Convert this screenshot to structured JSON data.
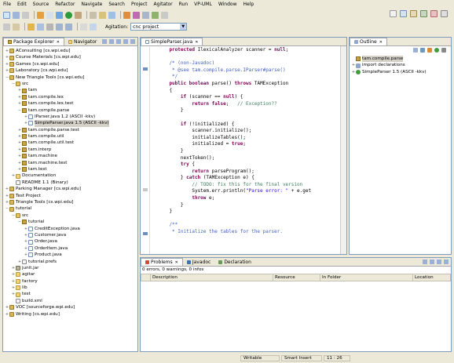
{
  "menu": [
    "File",
    "Edit",
    "Source",
    "Refactor",
    "Navigate",
    "Search",
    "Project",
    "Agitator",
    "Run",
    "VP-UML",
    "Window",
    "Help"
  ],
  "toolbar": {
    "agitation_label": "Agitation:",
    "agitation_value": "cnc project"
  },
  "package_explorer": {
    "tabs": [
      "Package Explorer",
      "Navigator"
    ],
    "tree": [
      {
        "depth": 0,
        "tw": "+",
        "icon": "proj",
        "label": "AConsulting  [cs.wpi.edu]"
      },
      {
        "depth": 0,
        "tw": "+",
        "icon": "proj",
        "label": "Course Materials  [cs.wpi.edu]"
      },
      {
        "depth": 0,
        "tw": "+",
        "icon": "proj",
        "label": "Games  [cs.wpi.edu]"
      },
      {
        "depth": 0,
        "tw": "+",
        "icon": "proj",
        "label": "Laboratory  [cs.wpi.edu]"
      },
      {
        "depth": 0,
        "tw": "−",
        "icon": "proj",
        "label": "New Triangle Tools  [cs.wpi.edu]"
      },
      {
        "depth": 1,
        "tw": "−",
        "icon": "src",
        "label": "src"
      },
      {
        "depth": 2,
        "tw": "+",
        "icon": "pkg",
        "label": "tam"
      },
      {
        "depth": 2,
        "tw": "+",
        "icon": "pkg",
        "label": "tam.compile.lex"
      },
      {
        "depth": 2,
        "tw": "+",
        "icon": "pkg",
        "label": "tam.compile.lex.test"
      },
      {
        "depth": 2,
        "tw": "−",
        "icon": "pkg",
        "label": "tam.compile.parse"
      },
      {
        "depth": 3,
        "tw": "+",
        "icon": "java",
        "label": "IParser.java 1.2  (ASCII -kkv)"
      },
      {
        "depth": 3,
        "tw": "+",
        "icon": "java",
        "label": "SimpleParser.java 1.5  (ASCII -kkv)",
        "selected": true
      },
      {
        "depth": 2,
        "tw": "+",
        "icon": "pkg",
        "label": "tam.compile.parse.test"
      },
      {
        "depth": 2,
        "tw": "+",
        "icon": "pkg",
        "label": "tam.compile.util"
      },
      {
        "depth": 2,
        "tw": "+",
        "icon": "pkg",
        "label": "tam.compile.util.test"
      },
      {
        "depth": 2,
        "tw": "+",
        "icon": "pkg",
        "label": "tam.interp"
      },
      {
        "depth": 2,
        "tw": "+",
        "icon": "pkg",
        "label": "tam.machine"
      },
      {
        "depth": 2,
        "tw": "+",
        "icon": "pkg",
        "label": "tam.machine.test"
      },
      {
        "depth": 2,
        "tw": "+",
        "icon": "pkg",
        "label": "tam.test"
      },
      {
        "depth": 1,
        "tw": "+",
        "icon": "folder",
        "label": "Documentation"
      },
      {
        "depth": 1,
        "tw": "",
        "icon": "file",
        "label": "README 1.1  (Binary)"
      },
      {
        "depth": 0,
        "tw": "+",
        "icon": "proj",
        "label": "Parking Manager  [cs.wpi.edu]"
      },
      {
        "depth": 0,
        "tw": "+",
        "icon": "proj",
        "label": "Test Project"
      },
      {
        "depth": 0,
        "tw": "+",
        "icon": "proj",
        "label": "Triangle Tools  [cs.wpi.edu]"
      },
      {
        "depth": 0,
        "tw": "−",
        "icon": "proj",
        "label": "tutorial"
      },
      {
        "depth": 1,
        "tw": "−",
        "icon": "src",
        "label": "src"
      },
      {
        "depth": 2,
        "tw": "−",
        "icon": "pkg",
        "label": "tutorial"
      },
      {
        "depth": 3,
        "tw": "+",
        "icon": "java",
        "label": "CreditException.java"
      },
      {
        "depth": 3,
        "tw": "+",
        "icon": "java",
        "label": "Customer.java"
      },
      {
        "depth": 3,
        "tw": "+",
        "icon": "java",
        "label": "Order.java"
      },
      {
        "depth": 3,
        "tw": "+",
        "icon": "java",
        "label": "OrderItem.java"
      },
      {
        "depth": 3,
        "tw": "+",
        "icon": "java",
        "label": "Product.java"
      },
      {
        "depth": 2,
        "tw": "+",
        "icon": "file",
        "label": "tutorial.prefs"
      },
      {
        "depth": 1,
        "tw": "+",
        "icon": "lib",
        "label": "junit.jar"
      },
      {
        "depth": 1,
        "tw": "+",
        "icon": "folder",
        "label": "agitar"
      },
      {
        "depth": 1,
        "tw": "+",
        "icon": "folder",
        "label": "factory"
      },
      {
        "depth": 1,
        "tw": "+",
        "icon": "folder",
        "label": "lib"
      },
      {
        "depth": 1,
        "tw": "+",
        "icon": "folder",
        "label": "test"
      },
      {
        "depth": 1,
        "tw": "",
        "icon": "file",
        "label": "build.xml"
      },
      {
        "depth": 0,
        "tw": "+",
        "icon": "proj",
        "label": "VOC  [sourceforge.wpi.edu]"
      },
      {
        "depth": 0,
        "tw": "+",
        "icon": "proj",
        "label": "Writing  [cs.wpi.edu]"
      }
    ]
  },
  "editor": {
    "tab_label": "SimpleParser.java",
    "lines": [
      [
        [
          "kw",
          "    protected "
        ],
        [
          "",
          "IlexicalAnalyzer scanner = "
        ],
        [
          "kw",
          "null"
        ],
        [
          "",
          ";"
        ]
      ],
      [
        [
          "",
          ""
        ]
      ],
      [
        [
          "cm",
          "    /* (non-Javadoc)"
        ]
      ],
      [
        [
          "cm",
          "     * @see tam.compile.parse.IParser#parse()"
        ]
      ],
      [
        [
          "cm",
          "     */"
        ]
      ],
      [
        [
          "kw",
          "    public boolean "
        ],
        [
          "",
          "parse() "
        ],
        [
          "kw",
          "throws "
        ],
        [
          "",
          "TAMException"
        ]
      ],
      [
        [
          "",
          "    {"
        ]
      ],
      [
        [
          "kw",
          "        if "
        ],
        [
          "",
          "(scanner == "
        ],
        [
          "kw",
          "null"
        ],
        [
          "",
          ") {"
        ]
      ],
      [
        [
          "kw",
          "            return false"
        ],
        [
          "",
          ";   "
        ],
        [
          "cm2",
          "// Exception??"
        ]
      ],
      [
        [
          "",
          "        }"
        ]
      ],
      [
        [
          "",
          ""
        ]
      ],
      [
        [
          "kw",
          "        if "
        ],
        [
          "",
          "(!initialized) {"
        ]
      ],
      [
        [
          "",
          "            scanner.initialize();"
        ]
      ],
      [
        [
          "",
          "            initializeTables();"
        ]
      ],
      [
        [
          "",
          "            initialized = "
        ],
        [
          "kw",
          "true"
        ],
        [
          "",
          ";"
        ]
      ],
      [
        [
          "",
          "        }"
        ]
      ],
      [
        [
          "",
          "        nextToken();"
        ]
      ],
      [
        [
          "kw",
          "        try "
        ],
        [
          "",
          "{"
        ]
      ],
      [
        [
          "kw",
          "            return "
        ],
        [
          "",
          "parseProgram();"
        ]
      ],
      [
        [
          "",
          "        } "
        ],
        [
          "kw",
          "catch "
        ],
        [
          "",
          "(TAMException e) {"
        ]
      ],
      [
        [
          "cm2",
          "            // TODO: fix this for the final version"
        ]
      ],
      [
        [
          "",
          "            System.err.println("
        ],
        [
          "st",
          "\"Parse error: \""
        ],
        [
          "",
          " + e.get"
        ]
      ],
      [
        [
          "kw",
          "            throw "
        ],
        [
          "",
          "e;"
        ]
      ],
      [
        [
          "",
          "        }"
        ]
      ],
      [
        [
          "",
          "    }"
        ]
      ],
      [
        [
          "",
          ""
        ]
      ],
      [
        [
          "cm",
          "    /**"
        ]
      ],
      [
        [
          "cm",
          "     * Initialize the tables for the parser."
        ]
      ]
    ]
  },
  "outline": {
    "tab_label": "Outline",
    "items": [
      {
        "depth": 0,
        "tw": "",
        "icon": "pkg",
        "label": "tam.compile.parse",
        "selected": true
      },
      {
        "depth": 0,
        "tw": "+",
        "icon": "imp",
        "label": "import declarations"
      },
      {
        "depth": 0,
        "tw": "+",
        "icon": "cls",
        "label": "SimpleParser  1.5  (ASCII -kkv)"
      }
    ]
  },
  "problems": {
    "tabs": [
      "Problems",
      "Javadoc",
      "Declaration"
    ],
    "summary": "0 errors, 0 warnings, 0 infos",
    "columns": [
      "",
      "Description",
      "Resource",
      "In Folder",
      "Location"
    ]
  },
  "status": {
    "writable": "Writable",
    "insert": "Smart Insert",
    "position": "11 : 26"
  },
  "colors": {
    "keyword": "#7f0055",
    "comment": "#3f5fbf",
    "line_comment": "#3f7f5f",
    "string": "#2a00ff",
    "chrome": "#ece9d8",
    "border": "#7f9db9"
  }
}
